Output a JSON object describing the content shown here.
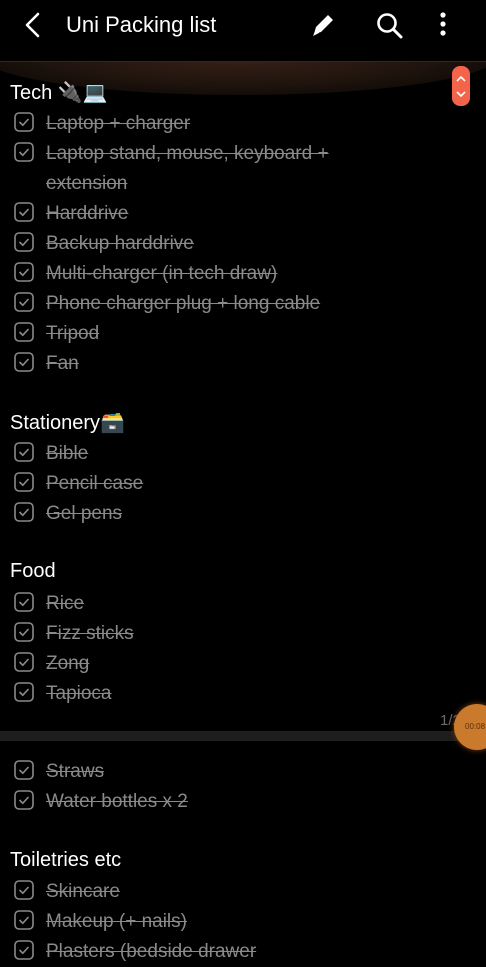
{
  "header": {
    "back_icon": "back-arrow-icon",
    "title": "Uni Packing list",
    "edit_icon": "pen-icon",
    "search_icon": "search-icon",
    "more_icon": "more-vert-icon"
  },
  "scroll_handle_icon": "scroll-up-down-icon",
  "sections": [
    {
      "title": "Tech 🔌💻",
      "items": [
        "Laptop + charger",
        "Laptop stand, mouse, keyboard + extension",
        "Harddrive",
        "Backup harddrive",
        "Multi-charger (in tech draw)",
        "Phone charger plug + long cable",
        "Tripod ",
        "Fan"
      ]
    },
    {
      "title": "Stationery🗃️",
      "items": [
        "Bible",
        "Pencil case",
        "Gel pens"
      ]
    },
    {
      "title": "Food",
      "items": [
        "Rice",
        "Fizz sticks",
        "Zong",
        "Tapioca",
        "Straws",
        "Water bottles x 2"
      ]
    },
    {
      "title": "Toiletries etc",
      "items": [
        "Skincare",
        "Makeup (+ nails)",
        "Plasters (bedside drawer"
      ]
    }
  ],
  "page_indicator": "1/2",
  "bubble_text": "00:08",
  "colors": {
    "background": "#000000",
    "checked_text": "#8a8a8a",
    "accent": "#f4644a"
  }
}
